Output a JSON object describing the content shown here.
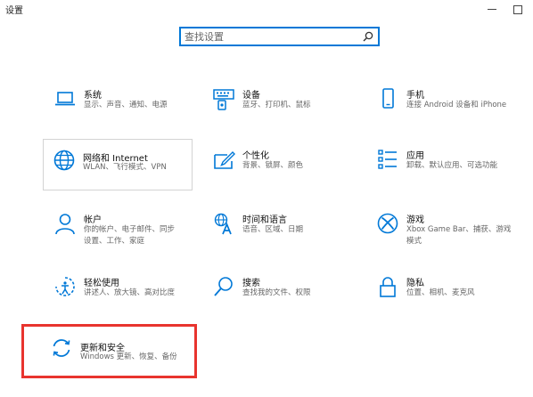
{
  "window": {
    "title": "设置"
  },
  "search": {
    "placeholder": "查找设置"
  },
  "tiles": [
    {
      "name": "系统",
      "desc": "显示、声音、通知、电源",
      "icon": "laptop-icon"
    },
    {
      "name": "设备",
      "desc": "蓝牙、打印机、鼠标",
      "icon": "keyboard-icon"
    },
    {
      "name": "手机",
      "desc": "连接 Android 设备和 iPhone",
      "icon": "phone-icon"
    },
    {
      "name": "网络和 Internet",
      "desc": "WLAN、飞行模式、VPN",
      "icon": "globe-icon"
    },
    {
      "name": "个性化",
      "desc": "背景、锁屏、颜色",
      "icon": "paint-icon"
    },
    {
      "name": "应用",
      "desc": "卸载、默认应用、可选功能",
      "icon": "apps-list-icon"
    },
    {
      "name": "帐户",
      "desc": "你的帐户、电子邮件、同步设置、工作、家庭",
      "icon": "person-icon"
    },
    {
      "name": "时间和语言",
      "desc": "语音、区域、日期",
      "icon": "language-icon"
    },
    {
      "name": "游戏",
      "desc": "Xbox Game Bar、捕获、游戏模式",
      "icon": "xbox-icon"
    },
    {
      "name": "轻松使用",
      "desc": "讲述人、放大镜、高对比度",
      "icon": "ease-of-access-icon"
    },
    {
      "name": "搜索",
      "desc": "查找我的文件、权限",
      "icon": "search-icon"
    },
    {
      "name": "隐私",
      "desc": "位置、相机、麦克风",
      "icon": "lock-icon"
    },
    {
      "name": "更新和安全",
      "desc": "Windows 更新、恢复、备份",
      "icon": "update-icon"
    }
  ],
  "colors": {
    "accent": "#0078d7",
    "highlight": "#e8342e"
  }
}
